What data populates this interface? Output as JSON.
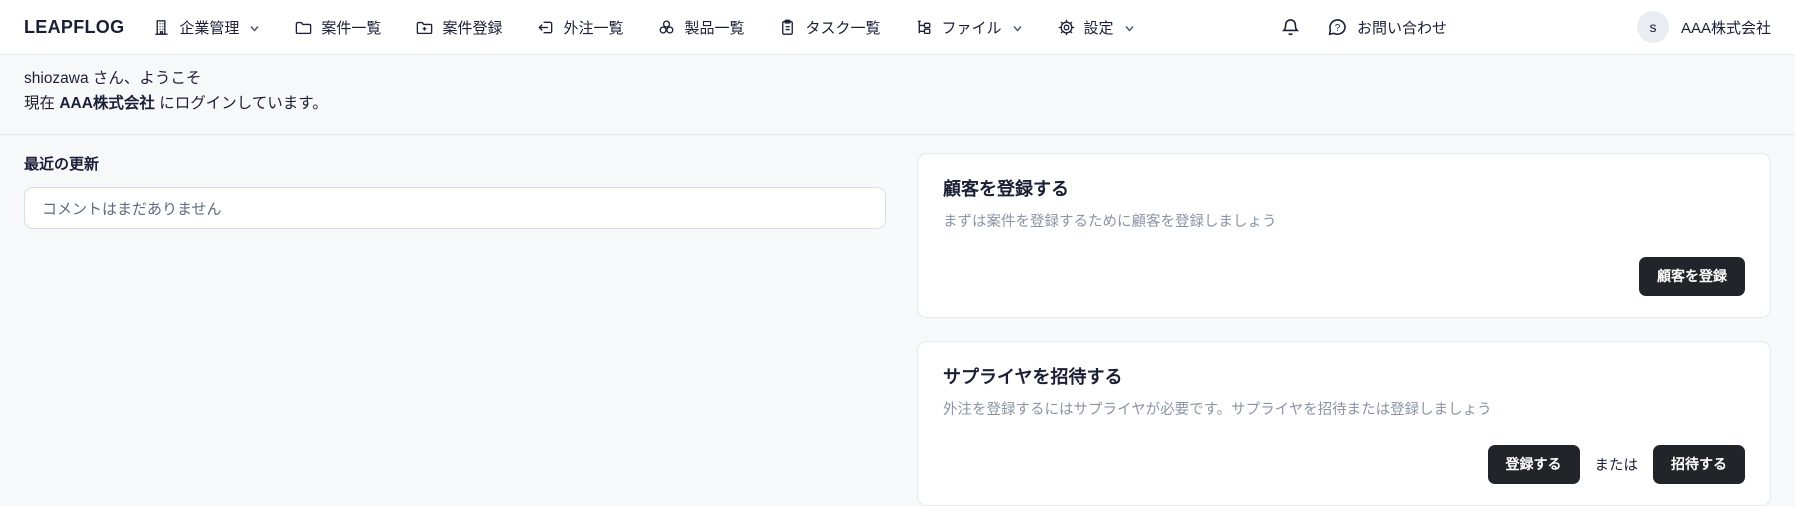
{
  "brand": "LEAPFLOG",
  "navbar": {
    "items": [
      {
        "label": "企業管理",
        "icon": "building-icon",
        "has_chevron": true
      },
      {
        "label": "案件一覧",
        "icon": "folder-icon",
        "has_chevron": false
      },
      {
        "label": "案件登録",
        "icon": "folder-plus-icon",
        "has_chevron": false
      },
      {
        "label": "外注一覧",
        "icon": "folder-return-icon",
        "has_chevron": false
      },
      {
        "label": "製品一覧",
        "icon": "circles-icon",
        "has_chevron": false
      },
      {
        "label": "タスク一覧",
        "icon": "clipboard-icon",
        "has_chevron": false
      },
      {
        "label": "ファイル",
        "icon": "tree-icon",
        "has_chevron": true
      },
      {
        "label": "設定",
        "icon": "gear-icon",
        "has_chevron": true
      }
    ],
    "contact_label": "お問い合わせ",
    "account": {
      "avatar_initial": "s",
      "company_name": "AAA株式会社"
    }
  },
  "welcome": {
    "line1": "shiozawa さん、ようこそ",
    "line2_prefix": "現在 ",
    "line2_company": "AAA株式会社",
    "line2_suffix": " にログインしています。"
  },
  "recent_updates": {
    "title": "最近の更新",
    "empty_message": "コメントはまだありません"
  },
  "cards": [
    {
      "title": "顧客を登録する",
      "description": "まずは案件を登録するために顧客を登録しましょう",
      "primary_button": "顧客を登録"
    },
    {
      "title": "サプライヤを招待する",
      "description": "外注を登録するにはサプライヤが必要です。サプライヤを招待または登録しましょう",
      "register_button": "登録する",
      "separator_text": "または",
      "invite_button": "招待する"
    }
  ],
  "colors": {
    "page_background": "#f7f8fa",
    "navbar_background": "#ffffff",
    "border": "#e5e9ef",
    "text_primary": "#1a1f36",
    "text_muted": "#8a94a6",
    "button_dark": "#212529",
    "avatar_background": "#e9edf3"
  }
}
